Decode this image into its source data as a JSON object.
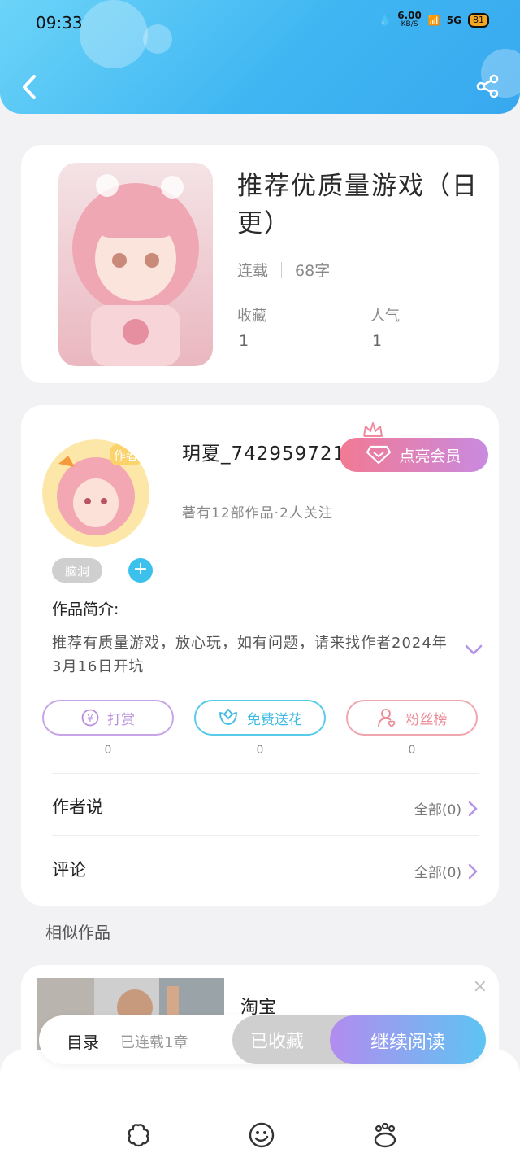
{
  "status_bar": {
    "time": "09:33",
    "net_speed": "6.00",
    "net_unit": "KB/S",
    "network": "5G",
    "battery": "81"
  },
  "header": {
    "back_icon": "chevron-left-icon",
    "share_icon": "share-icon",
    "accent_color": "#3fb6f2"
  },
  "book": {
    "title": "推荐优质量游戏（日更）",
    "status": "连载",
    "word_count": "68字",
    "favorites_label": "收藏",
    "favorites_value": "1",
    "popularity_label": "人气",
    "popularity_value": "1"
  },
  "author": {
    "badge": "作者",
    "name": "玥夏_742959721",
    "vip_label": "点亮会员",
    "info": "著有12部作品·2人关注",
    "tag": "脑洞",
    "tag_add": "+"
  },
  "intro": {
    "title": "作品简介:",
    "text": "推荐有质量游戏，放心玩，如有问题，请来找作者2024年3月16日开坑"
  },
  "actions": [
    {
      "label": "打赏",
      "count": "0",
      "icon": "yen-icon"
    },
    {
      "label": "免费送花",
      "count": "0",
      "icon": "flower-icon"
    },
    {
      "label": "粉丝榜",
      "count": "0",
      "icon": "fans-icon"
    }
  ],
  "rows": {
    "author_says": "作者说",
    "author_says_more": "全部(0)",
    "comments": "评论",
    "comments_more": "全部(0)"
  },
  "similar": {
    "title": "相似作品",
    "item_name": "淘宝",
    "close": "×"
  },
  "read_bar": {
    "toc": "目录",
    "toc_sub": "已连载1章",
    "collected": "已收藏",
    "continue": "继续阅读"
  },
  "bottom_nav": [
    "flower-nav-icon",
    "face-nav-icon",
    "paw-nav-icon"
  ]
}
